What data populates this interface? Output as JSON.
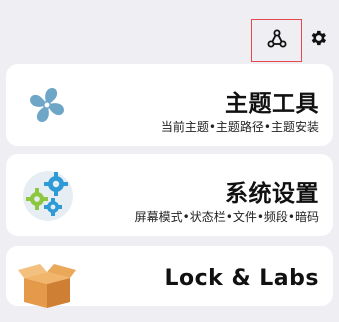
{
  "header": {
    "share_icon": "share-nodes-icon",
    "settings_icon": "gear-icon"
  },
  "cards": [
    {
      "title": "主题工具",
      "subtitle": "当前主题•主题路径•主题安装",
      "icon": "pinwheel-icon"
    },
    {
      "title": "系统设置",
      "subtitle": "屏幕模式•状态栏•文件•频段•暗码",
      "icon": "gears-icon"
    },
    {
      "title": "Lock & Labs",
      "icon": "box-icon"
    }
  ],
  "colors": {
    "background": "#efeff3",
    "card": "#ffffff",
    "highlight_border": "#e5484d",
    "gear_blue": "#2f9bd6",
    "gear_green": "#8dc63f",
    "box_orange": "#e59a4a"
  }
}
